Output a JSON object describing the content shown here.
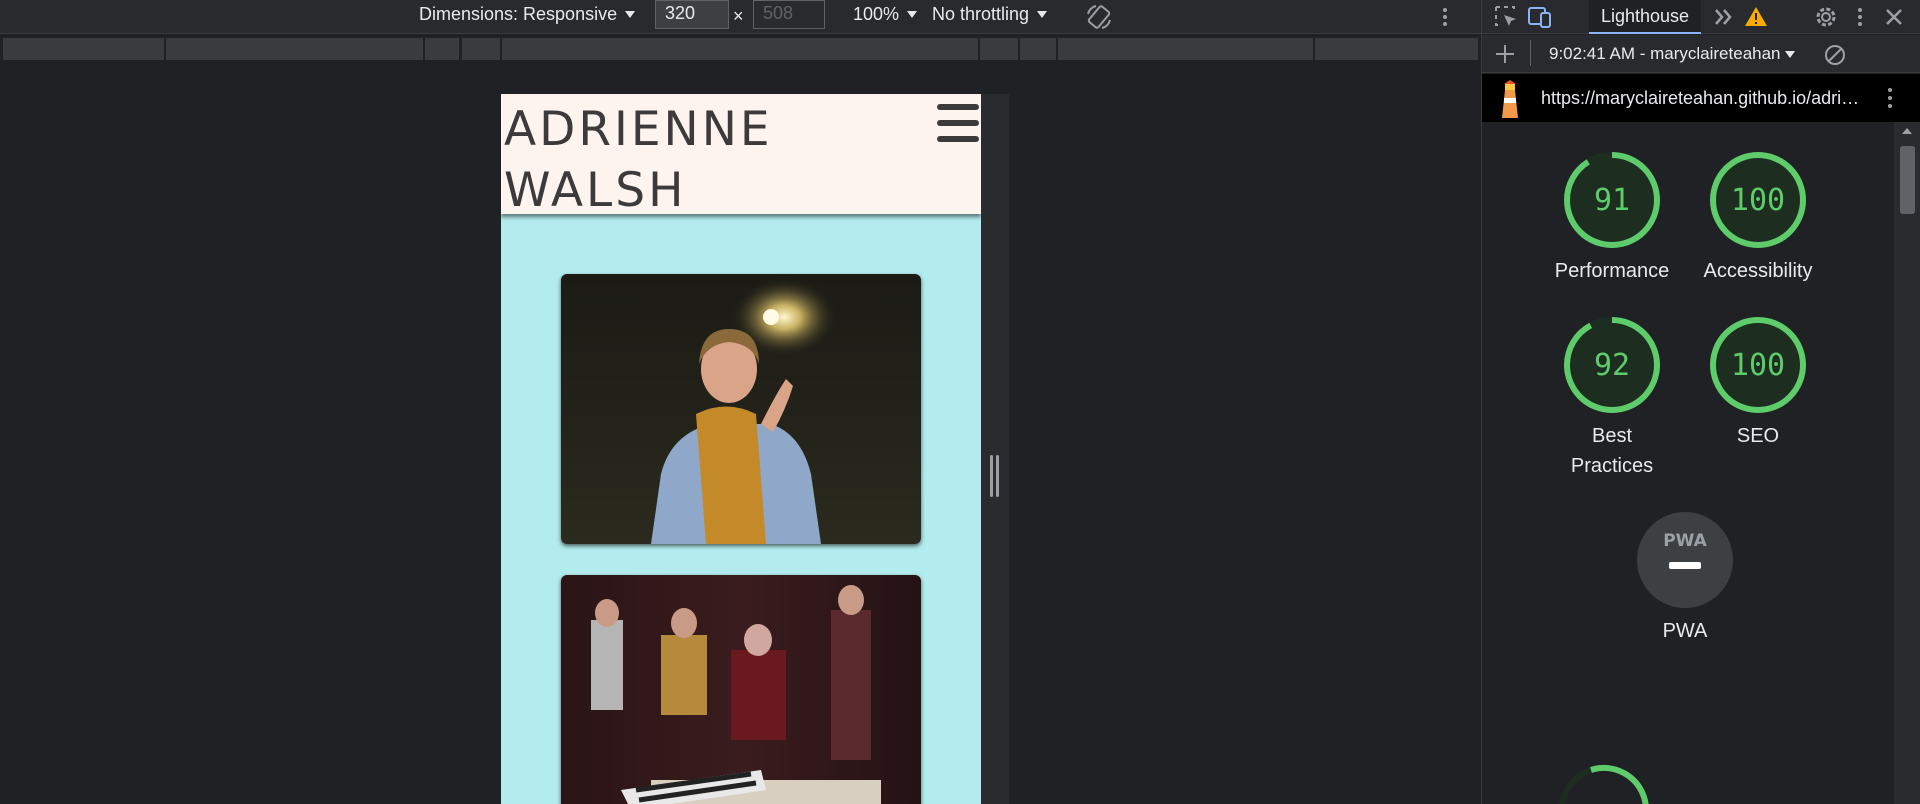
{
  "device_toolbar": {
    "dimensions_label": "Dimensions: Responsive",
    "width_value": "320",
    "height_placeholder": "508",
    "times": "×",
    "zoom": "100%",
    "throttling": "No throttling"
  },
  "emulated_page": {
    "site_title": "ADRIENNE WALSH",
    "background_color": "#b3ecee",
    "header_color": "#fdf4ef"
  },
  "devtools": {
    "active_tab": "Lighthouse",
    "report_selector": "9:02:41 AM - maryclaireteahan",
    "url": "https://maryclaireteahan.github.io/adri…",
    "pwa_badge_text": "PWA",
    "gauges": [
      {
        "label": "Performance",
        "score": "91",
        "value": 91
      },
      {
        "label": "Accessibility",
        "score": "100",
        "value": 100
      },
      {
        "label": "Best Practices",
        "score": "92",
        "value": 92
      },
      {
        "label": "SEO",
        "score": "100",
        "value": 100
      },
      {
        "label": "PWA",
        "score": "",
        "value": 0
      }
    ],
    "colors": {
      "pass": "#5ecc6b",
      "pass_bg": "#1d2e21",
      "pwa_bg": "#3c4043"
    }
  }
}
